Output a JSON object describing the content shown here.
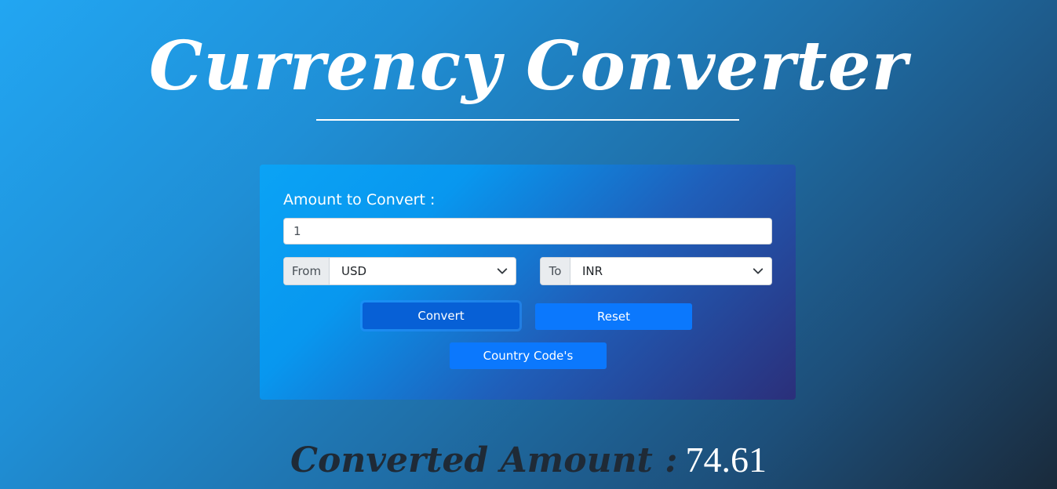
{
  "header": {
    "title": "Currency Converter"
  },
  "form": {
    "amount_label": "Amount to Convert :",
    "amount_value": "1",
    "from": {
      "addon_label": "From",
      "selected": "USD"
    },
    "to": {
      "addon_label": "To",
      "selected": "INR"
    },
    "buttons": {
      "convert": "Convert",
      "reset": "Reset",
      "country_codes": "Country Code's"
    }
  },
  "result": {
    "label": "Converted Amount :",
    "value": "74.61"
  },
  "icons": {
    "select_chevron": "chevron-down-icon"
  },
  "colors": {
    "button_primary": "#0b78fd",
    "button_active": "#0760d6",
    "text_white": "#ffffff",
    "result_label": "#1f2a36"
  }
}
